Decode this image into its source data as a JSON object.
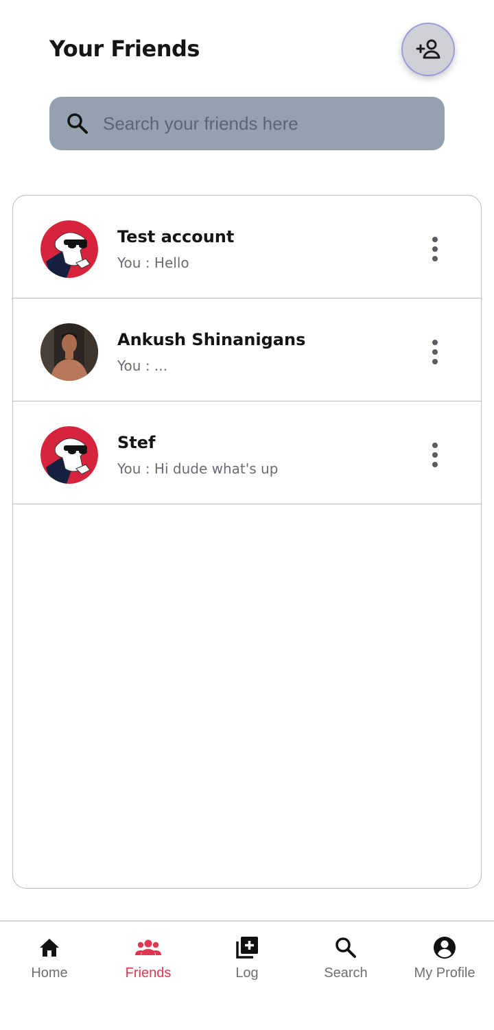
{
  "header": {
    "title": "Your Friends"
  },
  "search": {
    "placeholder": "Search your friends here",
    "value": ""
  },
  "friends": [
    {
      "name": "Test account",
      "preview": "You : Hello",
      "avatar": "bear-sunglasses-avatar"
    },
    {
      "name": "Ankush Shinanigans",
      "preview": "You : ...",
      "avatar": "photo-avatar"
    },
    {
      "name": "Stef",
      "preview": "You : Hi dude what's up",
      "avatar": "bear-sunglasses-avatar"
    }
  ],
  "nav": {
    "items": [
      {
        "label": "Home",
        "icon": "home-icon"
      },
      {
        "label": "Friends",
        "icon": "group-icon",
        "active": true
      },
      {
        "label": "Log",
        "icon": "add-library-icon"
      },
      {
        "label": "Search",
        "icon": "search-icon"
      },
      {
        "label": "My Profile",
        "icon": "account-circle-icon"
      }
    ]
  },
  "colors": {
    "accent": "#e03650",
    "search_bg": "#94a2b0",
    "add_button_bg": "#cfd0d6"
  }
}
